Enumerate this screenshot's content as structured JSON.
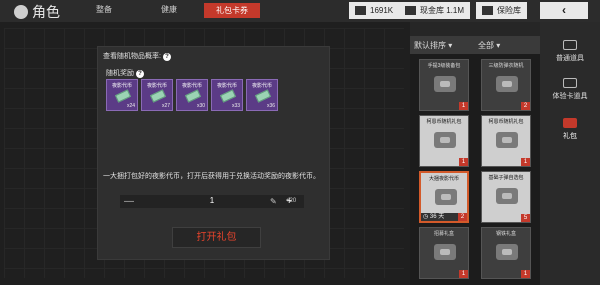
{
  "header": {
    "title": "角色",
    "tabs": [
      "整备",
      "健康",
      "礼包卡券"
    ],
    "resources": [
      {
        "label": "1691K",
        "icon": "currency-icon"
      },
      {
        "label": "现金库 1.1M",
        "icon": "cash-vault-icon"
      },
      {
        "label": "保险库",
        "icon": "safe-icon"
      }
    ],
    "back_icon": "‹"
  },
  "panel": {
    "probability_label": "查看随机物品概率:",
    "random_rewards_label": "随机奖励",
    "rewards": [
      {
        "name": "夜影代币",
        "qty": "x24"
      },
      {
        "name": "夜影代币",
        "qty": "x27"
      },
      {
        "name": "夜影代币",
        "qty": "x30"
      },
      {
        "name": "夜影代币",
        "qty": "x33"
      },
      {
        "name": "夜影代币",
        "qty": "x36"
      }
    ],
    "description": "一大捆打包好的夜影代币，打开后获得用于兑换活动奖励的夜影代币。",
    "quantity": "1",
    "plus_twenty": "+20",
    "open_button": "打开礼包"
  },
  "list": {
    "sort_label": "默认排序",
    "filter_label": "全部",
    "items": [
      {
        "name": "手提3级装备包",
        "count": "1",
        "style": "grey"
      },
      {
        "name": "三级防弹衣随机",
        "count": "2",
        "style": "grey"
      },
      {
        "name": "柯恩币随机礼包",
        "count": "1",
        "style": "white"
      },
      {
        "name": "柯恩币随机礼包",
        "count": "1",
        "style": "white"
      },
      {
        "name": "大捆夜影代币",
        "count": "2",
        "days": "36 天",
        "style": "white",
        "selected": true
      },
      {
        "name": "基础子弹自选包",
        "count": "5",
        "style": "grey"
      },
      {
        "name": "招募礼盒",
        "count": "1",
        "style": "grey"
      },
      {
        "name": "钢铁礼盒",
        "count": "1",
        "style": "grey"
      }
    ]
  },
  "categories": [
    {
      "label": "普通道具",
      "icon": "card-icon"
    },
    {
      "label": "体验卡道具",
      "icon": "trial-card-icon"
    },
    {
      "label": "礼包",
      "icon": "gift-icon",
      "active": true
    }
  ]
}
